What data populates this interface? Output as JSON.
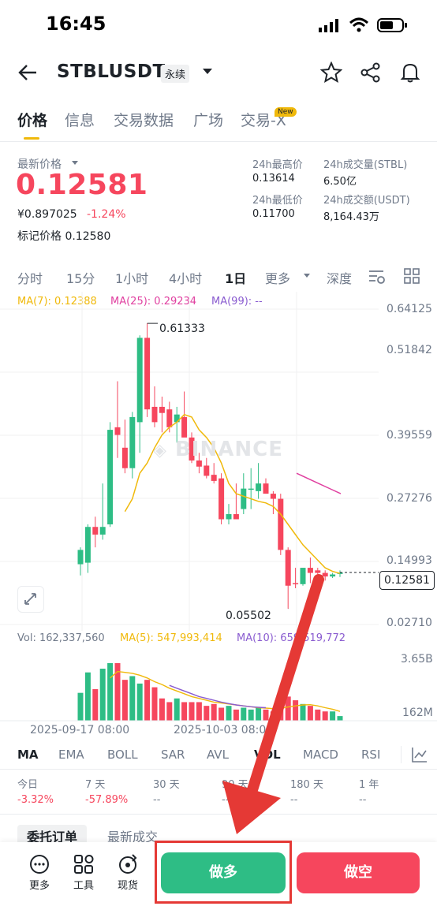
{
  "status": {
    "time": "16:45"
  },
  "header": {
    "pair": "STBLUSDT",
    "contract_tag": "永续"
  },
  "tabs": [
    {
      "label": "价格",
      "active": true
    },
    {
      "label": "信息"
    },
    {
      "label": "交易数据"
    },
    {
      "label": "广场"
    },
    {
      "label": "交易-X",
      "badge": "New"
    }
  ],
  "price": {
    "label": "最新价格",
    "last": "0.12581",
    "cny": "¥0.897025",
    "change": "-1.24%",
    "mark_label": "标记价格",
    "mark_value": "0.12580"
  },
  "stats": {
    "high_label": "24h最高价",
    "high_value": "0.13614",
    "vol_stbl_label": "24h成交量(STBL)",
    "vol_stbl_value": "6.50亿",
    "low_label": "24h最低价",
    "low_value": "0.11700",
    "vol_usdt_label": "24h成交额(USDT)",
    "vol_usdt_value": "8,164.43万"
  },
  "intervals": {
    "items": [
      "分时",
      "15分",
      "1小时",
      "4小时",
      "1日",
      "更多",
      "深度"
    ],
    "active": "1日"
  },
  "ma_legend": {
    "ma7": "MA(7): 0.12388",
    "ma25": "MA(25): 0.29234",
    "ma99": "MA(99): --"
  },
  "y_axis": [
    "0.64125",
    "0.51842",
    "0.39559",
    "0.27276",
    "0.14993",
    "0.02710"
  ],
  "current_price_tag": "0.12581",
  "annotations": {
    "high": "0.61333",
    "low": "0.05502"
  },
  "watermark": "BINANCE",
  "volume": {
    "vol": "Vol: 162,337,560",
    "ma5": "MA(5): 547,993,414",
    "ma10": "MA(10): 659,519,772",
    "y_top": "3.65B",
    "y_bottom": "162M"
  },
  "x_axis": [
    "2025-09-17 08:00",
    "2025-10-03 08:00"
  ],
  "indicators": {
    "items": [
      "MA",
      "EMA",
      "BOLL",
      "SAR",
      "AVL",
      "VOL",
      "MACD",
      "RSI"
    ],
    "active": "MA"
  },
  "performance": [
    {
      "label": "今日",
      "value": "-3.32%"
    },
    {
      "label": "7 天",
      "value": "-57.89%"
    },
    {
      "label": "30 天",
      "value": "--"
    },
    {
      "label": "90 天",
      "value": "--"
    },
    {
      "label": "180 天",
      "value": "--"
    },
    {
      "label": "1 年",
      "value": "--"
    }
  ],
  "order_tabs": [
    "委托订单",
    "最新成交"
  ],
  "bottom": {
    "more": "更多",
    "tools": "工具",
    "spot": "现货",
    "long": "做多",
    "short": "做空"
  },
  "colors": {
    "up": "#2ebd85",
    "down": "#f6465d",
    "accent": "#f0b90b",
    "ma7": "#f0b90b",
    "ma25": "#e040a0",
    "ma99": "#8a5cd0",
    "annotation_arrow": "#e53935"
  },
  "chart_data": {
    "type": "candlestick",
    "ylim": [
      0.0271,
      0.64125
    ],
    "high_marker": 0.61333,
    "low_marker": 0.05502,
    "current": 0.12581,
    "candles": [
      {
        "o": 0.142,
        "h": 0.175,
        "l": 0.12,
        "c": 0.17
      },
      {
        "o": 0.145,
        "h": 0.22,
        "l": 0.125,
        "c": 0.215
      },
      {
        "o": 0.215,
        "h": 0.235,
        "l": 0.175,
        "c": 0.2
      },
      {
        "o": 0.2,
        "h": 0.3,
        "l": 0.19,
        "c": 0.215
      },
      {
        "o": 0.22,
        "h": 0.42,
        "l": 0.215,
        "c": 0.405
      },
      {
        "o": 0.41,
        "h": 0.5,
        "l": 0.35,
        "c": 0.395
      },
      {
        "o": 0.37,
        "h": 0.425,
        "l": 0.32,
        "c": 0.33
      },
      {
        "o": 0.33,
        "h": 0.44,
        "l": 0.31,
        "c": 0.43
      },
      {
        "o": 0.42,
        "h": 0.59,
        "l": 0.36,
        "c": 0.585
      },
      {
        "o": 0.585,
        "h": 0.6133,
        "l": 0.43,
        "c": 0.445
      },
      {
        "o": 0.45,
        "h": 0.49,
        "l": 0.41,
        "c": 0.42
      },
      {
        "o": 0.45,
        "h": 0.47,
        "l": 0.4,
        "c": 0.438
      },
      {
        "o": 0.445,
        "h": 0.46,
        "l": 0.4,
        "c": 0.41
      },
      {
        "o": 0.42,
        "h": 0.45,
        "l": 0.38,
        "c": 0.435
      },
      {
        "o": 0.43,
        "h": 0.48,
        "l": 0.4,
        "c": 0.39
      },
      {
        "o": 0.39,
        "h": 0.4,
        "l": 0.34,
        "c": 0.345
      },
      {
        "o": 0.345,
        "h": 0.36,
        "l": 0.32,
        "c": 0.333
      },
      {
        "o": 0.335,
        "h": 0.35,
        "l": 0.31,
        "c": 0.315
      },
      {
        "o": 0.317,
        "h": 0.34,
        "l": 0.3,
        "c": 0.305
      },
      {
        "o": 0.31,
        "h": 0.32,
        "l": 0.22,
        "c": 0.23
      },
      {
        "o": 0.23,
        "h": 0.26,
        "l": 0.22,
        "c": 0.24
      },
      {
        "o": 0.24,
        "h": 0.3,
        "l": 0.23,
        "c": 0.23
      },
      {
        "o": 0.25,
        "h": 0.32,
        "l": 0.24,
        "c": 0.29
      },
      {
        "o": 0.29,
        "h": 0.33,
        "l": 0.25,
        "c": 0.29
      },
      {
        "o": 0.285,
        "h": 0.34,
        "l": 0.27,
        "c": 0.3
      },
      {
        "o": 0.3,
        "h": 0.31,
        "l": 0.28,
        "c": 0.28
      },
      {
        "o": 0.28,
        "h": 0.285,
        "l": 0.24,
        "c": 0.27
      },
      {
        "o": 0.27,
        "h": 0.28,
        "l": 0.16,
        "c": 0.17
      },
      {
        "o": 0.17,
        "h": 0.175,
        "l": 0.055,
        "c": 0.1
      },
      {
        "o": 0.105,
        "h": 0.135,
        "l": 0.095,
        "c": 0.103
      },
      {
        "o": 0.103,
        "h": 0.135,
        "l": 0.1,
        "c": 0.135
      },
      {
        "o": 0.135,
        "h": 0.155,
        "l": 0.105,
        "c": 0.125
      },
      {
        "o": 0.13,
        "h": 0.135,
        "l": 0.115,
        "c": 0.125
      },
      {
        "o": 0.125,
        "h": 0.13,
        "l": 0.11,
        "c": 0.118
      },
      {
        "o": 0.118,
        "h": 0.125,
        "l": 0.115,
        "c": 0.122
      },
      {
        "o": 0.123,
        "h": 0.13,
        "l": 0.117,
        "c": 0.1258
      }
    ],
    "ma7": [
      null,
      null,
      null,
      null,
      null,
      null,
      0.245,
      0.27,
      0.32,
      0.34,
      0.37,
      0.395,
      0.41,
      0.42,
      0.435,
      0.43,
      0.405,
      0.39,
      0.37,
      0.34,
      0.3,
      0.28,
      0.275,
      0.27,
      0.265,
      0.262,
      0.255,
      0.24,
      0.22,
      0.2,
      0.18,
      0.165,
      0.15,
      0.135,
      0.128,
      0.124
    ],
    "ma25": [
      null,
      null,
      null,
      null,
      null,
      null,
      null,
      null,
      null,
      null,
      null,
      null,
      null,
      null,
      null,
      null,
      null,
      null,
      null,
      null,
      null,
      null,
      null,
      null,
      0.32,
      0.318,
      0.316,
      0.312,
      0.305,
      0.296,
      0.292
    ],
    "volume_ylim": [
      0.162,
      3.65
    ],
    "volume_unit": "B",
    "volumes": [
      1.5,
      2.6,
      1.7,
      2.8,
      3.1,
      3.1,
      2.2,
      2.4,
      2.0,
      2.2,
      1.8,
      1.2,
      1.0,
      1.2,
      1.0,
      1.0,
      1.0,
      0.8,
      0.9,
      0.7,
      0.8,
      0.6,
      0.7,
      0.6,
      0.7,
      0.6,
      0.5,
      0.7,
      1.3,
      1.1,
      0.9,
      0.8,
      0.6,
      0.5,
      0.5,
      0.25
    ],
    "vol_ma5": [
      null,
      null,
      null,
      null,
      2.3,
      2.65,
      2.6,
      2.55,
      2.45,
      2.3,
      2.1,
      1.95,
      1.75,
      1.6,
      1.45,
      1.3,
      1.2,
      1.1,
      1.0,
      0.95,
      0.9,
      0.85,
      0.8,
      0.75,
      0.7,
      0.68,
      0.65,
      0.66,
      0.74,
      0.8,
      0.85,
      0.86,
      0.8,
      0.7,
      0.62,
      0.5
    ],
    "vol_ma10": [
      null,
      null,
      null,
      null,
      null,
      null,
      null,
      null,
      null,
      null,
      null,
      null,
      1.9,
      1.75,
      1.6,
      1.45,
      1.3,
      1.2,
      1.1,
      1.0,
      0.92,
      0.85,
      0.8,
      0.75,
      0.72,
      0.7
    ]
  }
}
